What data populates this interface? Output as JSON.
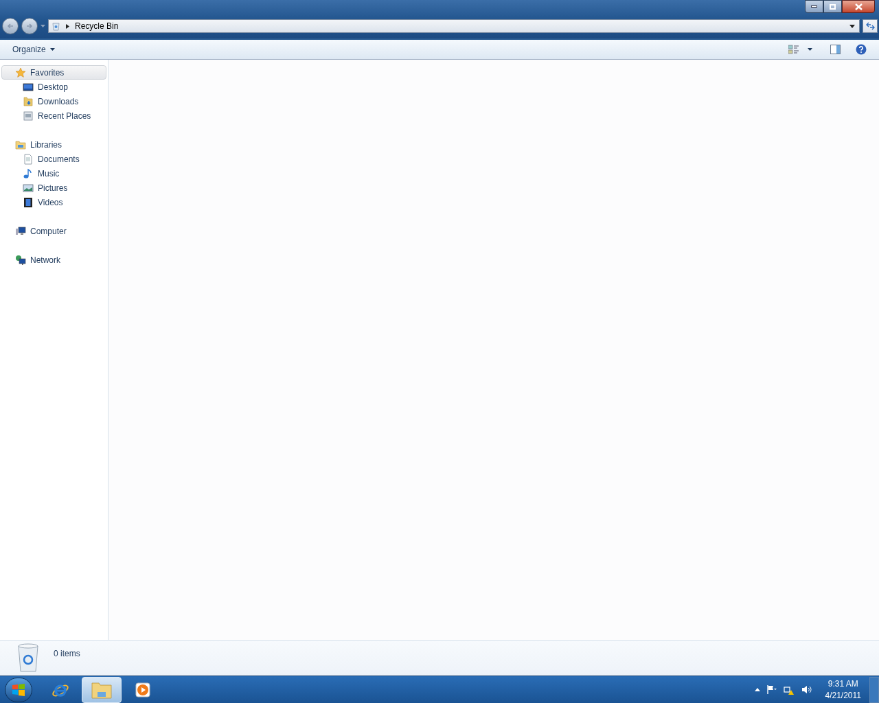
{
  "address_bar": {
    "path": [
      "Recycle Bin"
    ]
  },
  "toolbar": {
    "organize": "Organize"
  },
  "sidebar": {
    "groups": [
      {
        "label": "Favorites",
        "kind": "star",
        "selected": true,
        "children": [
          {
            "label": "Desktop",
            "kind": "desktop",
            "selected": false
          },
          {
            "label": "Downloads",
            "kind": "downloads",
            "selected": false
          },
          {
            "label": "Recent Places",
            "kind": "recent",
            "selected": false
          }
        ]
      },
      {
        "label": "Libraries",
        "kind": "library",
        "selected": false,
        "children": [
          {
            "label": "Documents",
            "kind": "document",
            "selected": false
          },
          {
            "label": "Music",
            "kind": "music",
            "selected": false
          },
          {
            "label": "Pictures",
            "kind": "pictures",
            "selected": false
          },
          {
            "label": "Videos",
            "kind": "videos",
            "selected": false
          }
        ]
      },
      {
        "label": "Computer",
        "kind": "computer",
        "selected": false
      },
      {
        "label": "Network",
        "kind": "network",
        "selected": false
      }
    ]
  },
  "status_bar": {
    "count": "0 items"
  },
  "taskbar": {
    "apps": [
      {
        "kind": "browser",
        "selected": false
      },
      {
        "kind": "explorer",
        "selected": true
      },
      {
        "kind": "media",
        "selected": false
      }
    ],
    "clock": {
      "time": "9:31 AM",
      "date": "4/21/2011"
    }
  }
}
